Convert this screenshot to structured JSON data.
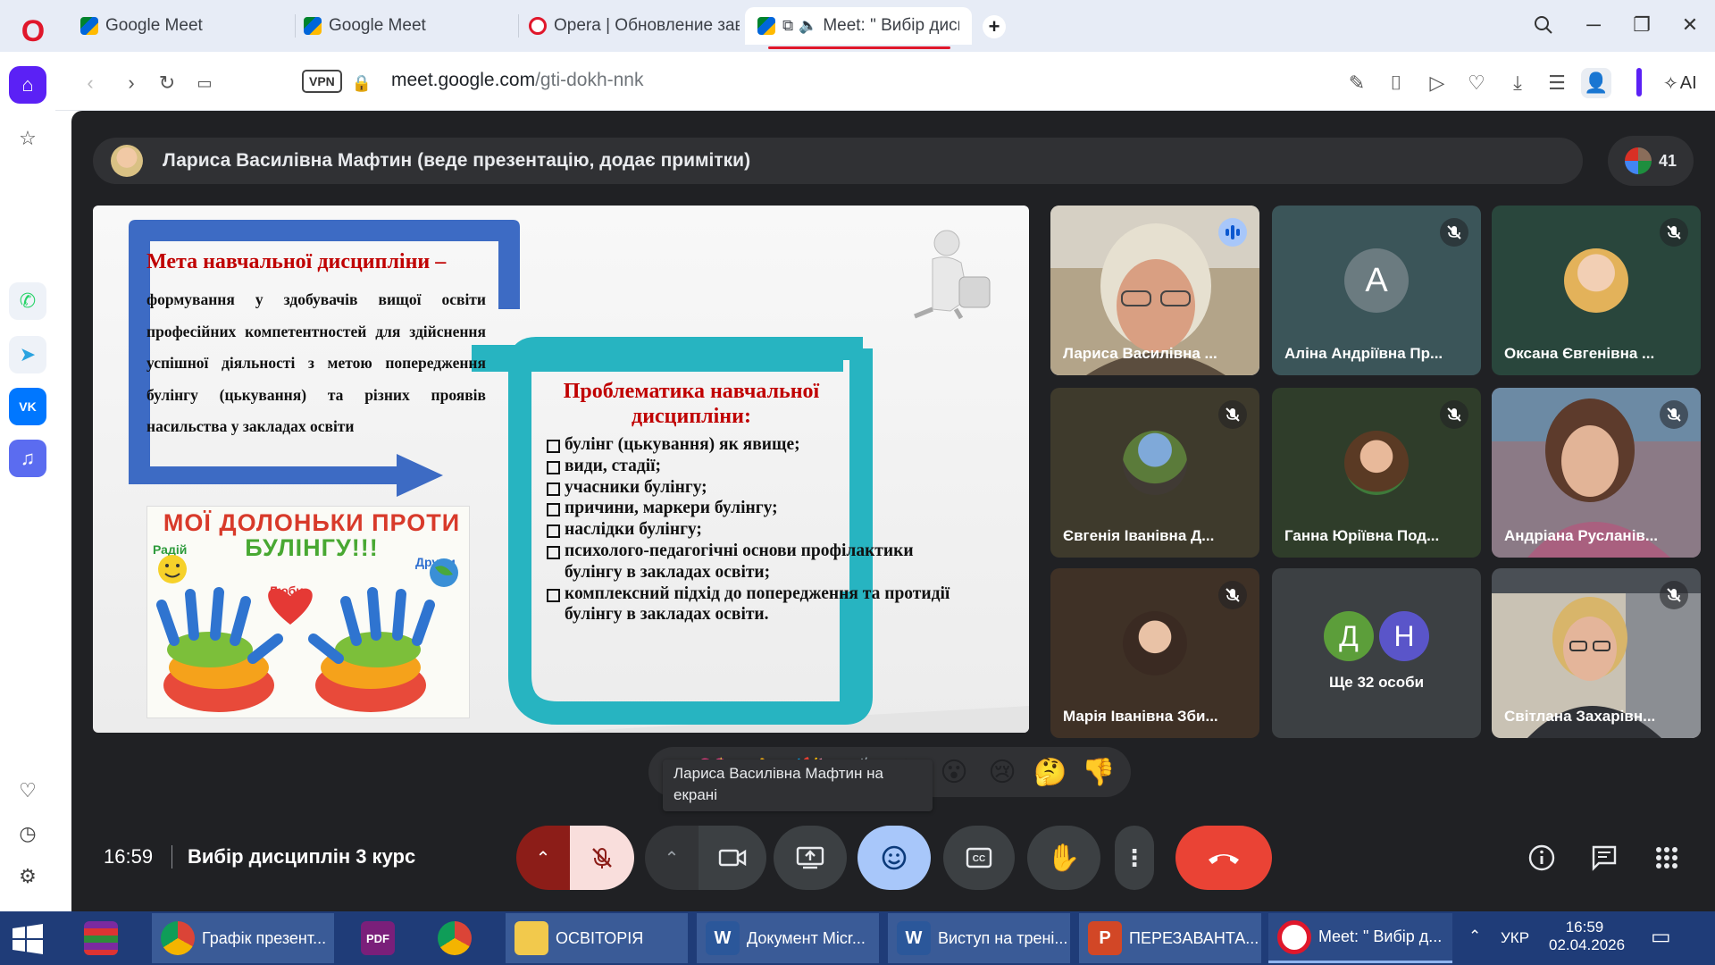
{
  "browser": {
    "tabs": [
      {
        "label": "Google Meet",
        "icon": "google-meet-icon"
      },
      {
        "label": "Google Meet",
        "icon": "google-meet-icon"
      },
      {
        "label": "Opera | Обновление заве",
        "icon": "opera-icon"
      },
      {
        "label": "Meet: \" Вибір дисц",
        "icon": "google-meet-icon",
        "active": true
      }
    ],
    "new_tab": "+",
    "url_domain": "meet.google.com",
    "url_path": "/gti-dokh-nnk",
    "vpn_label": "VPN",
    "ai_label": "AI",
    "accent_color": "#5b21f5"
  },
  "meeting": {
    "presenter_banner": "Лариса Василівна Мафтин (веде презентацію, додає примітки)",
    "participant_count": "41",
    "clock": "16:59",
    "title": "Вибір дисциплін 3 курс",
    "tooltip": "Лариса Василівна Мафтин на екрані",
    "reactions": [
      "💖",
      "👍",
      "🎉",
      "👏",
      "😂",
      "😮",
      "😢",
      "🤔",
      "👎"
    ],
    "end_call_color": "#ea4335"
  },
  "slide": {
    "goal_title": "Мета навчальної дисципліни –",
    "goal_body": "формування у здобувачів вищої освіти професійних компетентностей для здійснення успішної діяльності з метою попередження булінгу (цькування) та різних проявів насильства у закладах освіти",
    "problem_title": "Проблематика навчальної дисципліни:",
    "problems": [
      "булінг (цькування) як явище;",
      " види, стадії;",
      "учасники булінгу;",
      "причини, маркери булінгу;",
      "наслідки булінгу;",
      " психолого-педагогічні основи профілактики булінгу в закладах освіти;",
      "комплексний підхід до попередження та протидії булінгу в закладах освіти."
    ],
    "poster_title_line1": "МОЇ ДОЛОНЬКИ ПРОТИ",
    "poster_title_line2": "БУЛІНГУ!!!",
    "poster_words": [
      "Радій",
      "Люби",
      "Дружи"
    ]
  },
  "participants": [
    {
      "name": "Лариса Василівна ...",
      "state": "speaking"
    },
    {
      "name": "Аліна Андріївна Пр...",
      "initial": "A",
      "muted": true
    },
    {
      "name": "Оксана Євгенівна ...",
      "muted": true
    },
    {
      "name": "Євгенія Іванівна Д...",
      "muted": true
    },
    {
      "name": "Ганна Юріївна Под...",
      "muted": true
    },
    {
      "name": "Андріана Русланів...",
      "muted": true
    },
    {
      "name": "Марія Іванівна Зби...",
      "muted": true
    },
    {
      "name": "Ще 32 особи",
      "initials": [
        "Д",
        "Н"
      ]
    },
    {
      "name": "Світлана Захарівн...",
      "muted": true
    }
  ],
  "taskbar": {
    "items": [
      {
        "label": "Графік презент..."
      },
      {
        "label": "ОСВІТОРІЯ"
      },
      {
        "label": "Документ Micr..."
      },
      {
        "label": "Виступ на трені..."
      },
      {
        "label": "ПЕРЕЗАВАНТА..."
      },
      {
        "label": "Meet: \" Вибір д..."
      }
    ],
    "language": "УКР",
    "time": "16:59",
    "date": "02.04.2026"
  }
}
